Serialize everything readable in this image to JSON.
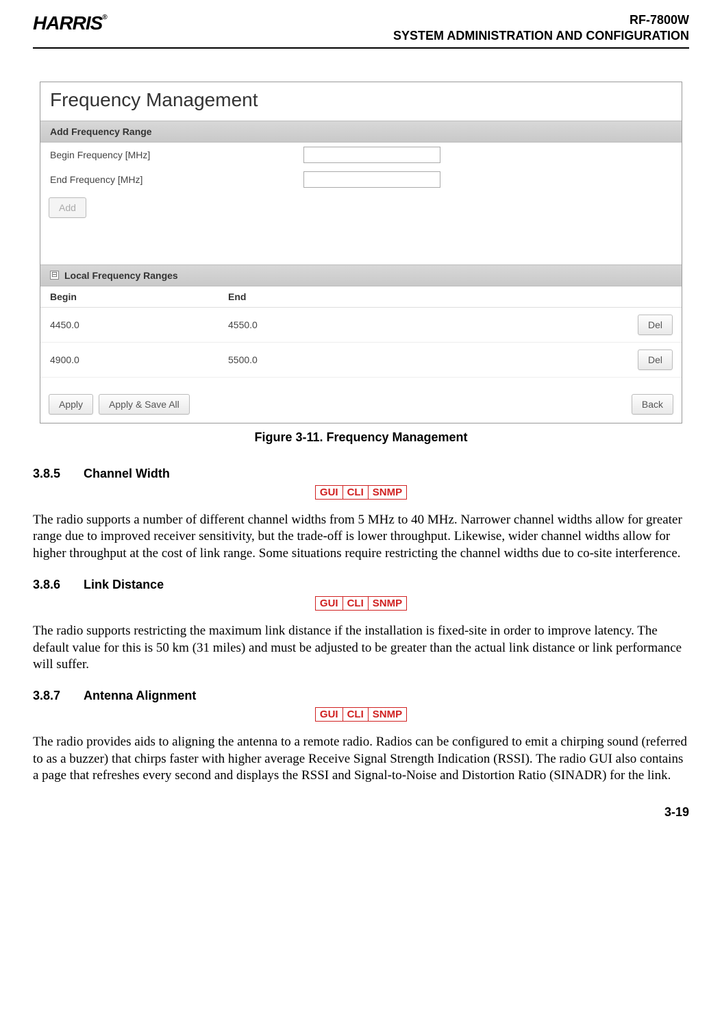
{
  "header": {
    "logo_text": "HARRIS",
    "reg_mark": "®",
    "line1": "RF-7800W",
    "line2": "SYSTEM ADMINISTRATION AND CONFIGURATION"
  },
  "screenshot": {
    "title": "Frequency Management",
    "add_section": "Add Frequency Range",
    "begin_label": "Begin Frequency [MHz]",
    "end_label": "End Frequency [MHz]",
    "add_btn": "Add",
    "local_section": "Local Frequency Ranges",
    "col_begin": "Begin",
    "col_end": "End",
    "rows": [
      {
        "begin": "4450.0",
        "end": "4550.0",
        "del": "Del"
      },
      {
        "begin": "4900.0",
        "end": "5500.0",
        "del": "Del"
      }
    ],
    "apply": "Apply",
    "apply_save": "Apply & Save All",
    "back": "Back"
  },
  "figure_caption": "Figure 3-11.  Frequency Management",
  "badges": {
    "gui": "GUI",
    "cli": "CLI",
    "snmp": "SNMP"
  },
  "s385": {
    "num": "3.8.5",
    "title": "Channel Width",
    "para": "The radio supports a number of different channel widths from 5 MHz to 40 MHz. Narrower channel widths allow for greater range due to improved receiver sensitivity, but the trade-off is lower throughput. Likewise, wider channel widths allow for higher throughput at the cost of link range. Some situations require restricting the channel widths due to co-site interference."
  },
  "s386": {
    "num": "3.8.6",
    "title": "Link Distance",
    "para": "The radio supports restricting the maximum link distance if the installation is fixed-site in order to improve latency. The default value for this is 50 km (31 miles) and must be adjusted to be greater than the actual link distance or link performance will suffer."
  },
  "s387": {
    "num": "3.8.7",
    "title": "Antenna Alignment",
    "para": "The radio provides aids to aligning the antenna to a remote radio. Radios can be configured to emit a chirping sound (referred to as a buzzer) that chirps faster with higher average Receive Signal Strength Indication (RSSI). The radio GUI also contains a page that refreshes every second and displays the RSSI and Signal-to-Noise and Distortion Ratio (SINADR) for the link."
  },
  "page_number": "3-19"
}
